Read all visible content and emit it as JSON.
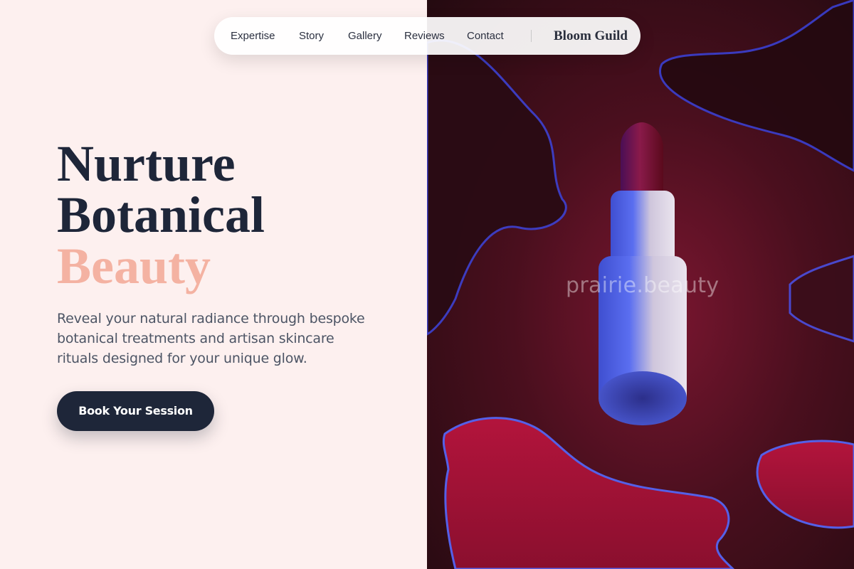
{
  "nav": {
    "links": [
      "Expertise",
      "Story",
      "Gallery",
      "Reviews",
      "Contact"
    ],
    "brand": "Bloom Guild"
  },
  "hero": {
    "title_line1": "Nurture",
    "title_line2": "Botanical",
    "title_accent": "Beauty",
    "subtitle": "Reveal your natural radiance through bespoke botanical treatments and artisan skincare rituals designed for your unique glow.",
    "cta_label": "Book Your Session"
  },
  "image": {
    "watermark": "prairie.beauty",
    "subject": "lipstick-photo"
  },
  "colors": {
    "background": "#fdf0ef",
    "text_dark": "#1e2639",
    "accent": "#f4b2a2",
    "button": "#1e2639"
  }
}
